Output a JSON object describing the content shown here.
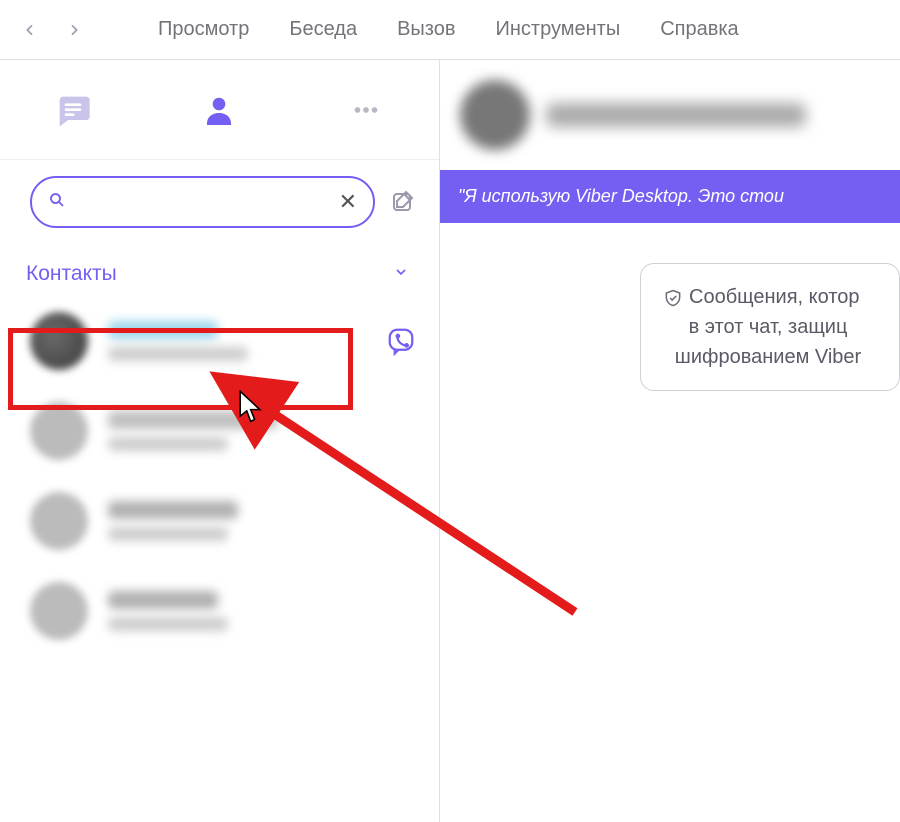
{
  "menu": {
    "items": [
      "Просмотр",
      "Беседа",
      "Вызов",
      "Инструменты",
      "Справка"
    ]
  },
  "search": {
    "placeholder": "",
    "value": ""
  },
  "sidebar": {
    "section_label": "Контакты"
  },
  "chat": {
    "status_banner": "\"Я использую Viber Desktop. Это стои",
    "info_line1": "Сообщения, котор",
    "info_line2": "в этот чат, защиц",
    "info_line3": "шифрованием Viber"
  },
  "colors": {
    "accent": "#7360f2",
    "highlight": "#e31b1b"
  }
}
